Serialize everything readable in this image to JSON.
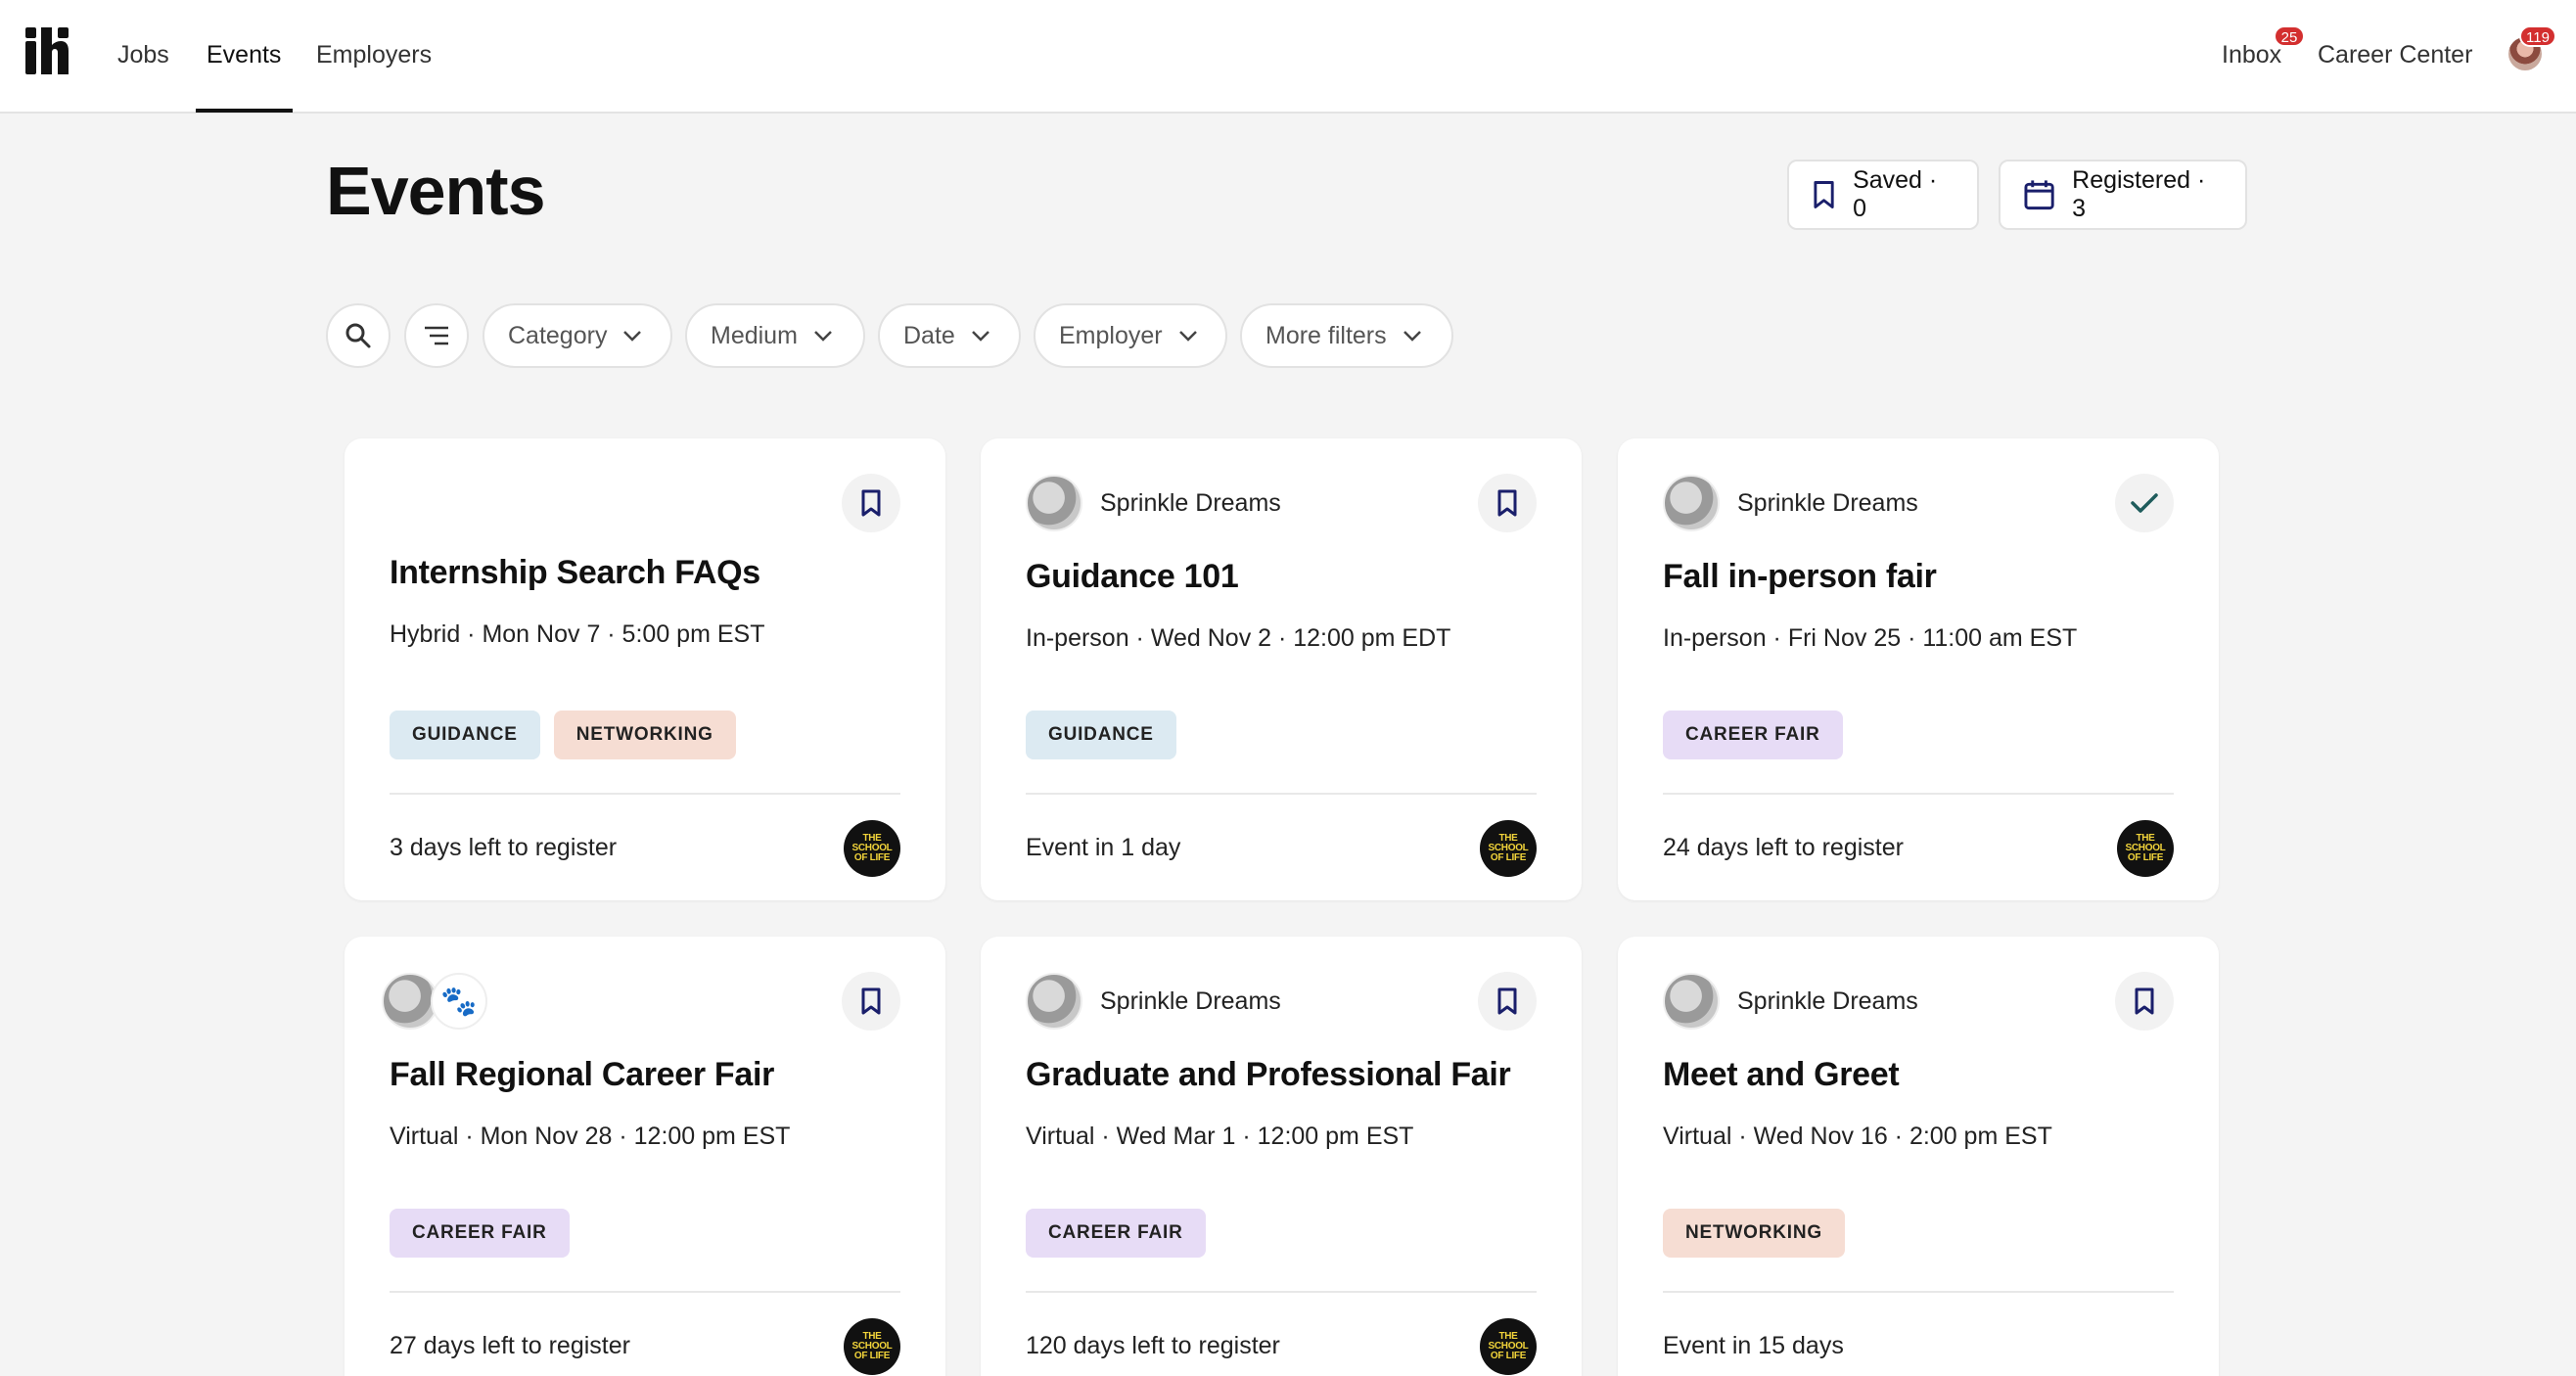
{
  "nav": {
    "links": [
      "Jobs",
      "Events",
      "Employers"
    ],
    "active": "Events",
    "inbox_label": "Inbox",
    "inbox_badge": "25",
    "career_center_label": "Career Center",
    "avatar_badge": "119"
  },
  "header": {
    "title": "Events",
    "saved_label": "Saved · 0",
    "registered_label": "Registered · 3"
  },
  "filters": {
    "icons": [
      "search-icon",
      "sort-icon"
    ],
    "pills": [
      "Category",
      "Medium",
      "Date",
      "Employer",
      "More filters"
    ]
  },
  "colors": {
    "accent_navy": "#1a1f6b",
    "check_teal": "#1f5c5c",
    "guidance_tag": "#dceaf2",
    "networking_tag": "#f6ddd3",
    "career_fair_tag": "#e7dcf6"
  },
  "events": [
    {
      "org": "",
      "title": "Internship Search FAQs",
      "meta": "Hybrid · Mon Nov 7 · 5:00 pm EST",
      "tags": [
        "GUIDANCE",
        "NETWORKING"
      ],
      "footer": "3 days left to register",
      "saved_state": "bookmark"
    },
    {
      "org": "Sprinkle Dreams",
      "title": "Guidance 101",
      "meta": "In-person · Wed Nov 2 · 12:00 pm EDT",
      "tags": [
        "GUIDANCE"
      ],
      "footer": "Event in 1 day",
      "saved_state": "bookmark"
    },
    {
      "org": "Sprinkle Dreams",
      "title": "Fall in-person fair",
      "meta": "In-person · Fri Nov 25 · 11:00 am EST",
      "tags": [
        "CAREER FAIR"
      ],
      "footer": "24 days left to register",
      "saved_state": "registered"
    },
    {
      "org": "",
      "title": "Fall Regional Career Fair",
      "meta": "Virtual · Mon Nov 28 · 12:00 pm EST",
      "tags": [
        "CAREER FAIR"
      ],
      "footer": "27 days left to register",
      "saved_state": "bookmark"
    },
    {
      "org": "Sprinkle Dreams",
      "title": "Graduate and Professional Fair",
      "meta": "Virtual · Wed Mar 1 · 12:00 pm EST",
      "tags": [
        "CAREER FAIR"
      ],
      "footer": "120 days left to register",
      "saved_state": "bookmark"
    },
    {
      "org": "Sprinkle Dreams",
      "title": "Meet and Greet",
      "meta": "Virtual · Wed Nov 16 · 2:00 pm EST",
      "tags": [
        "NETWORKING"
      ],
      "footer": "Event in 15 days",
      "saved_state": "bookmark"
    }
  ],
  "school_logo_text": "THE SCHOOL OF LIFE"
}
